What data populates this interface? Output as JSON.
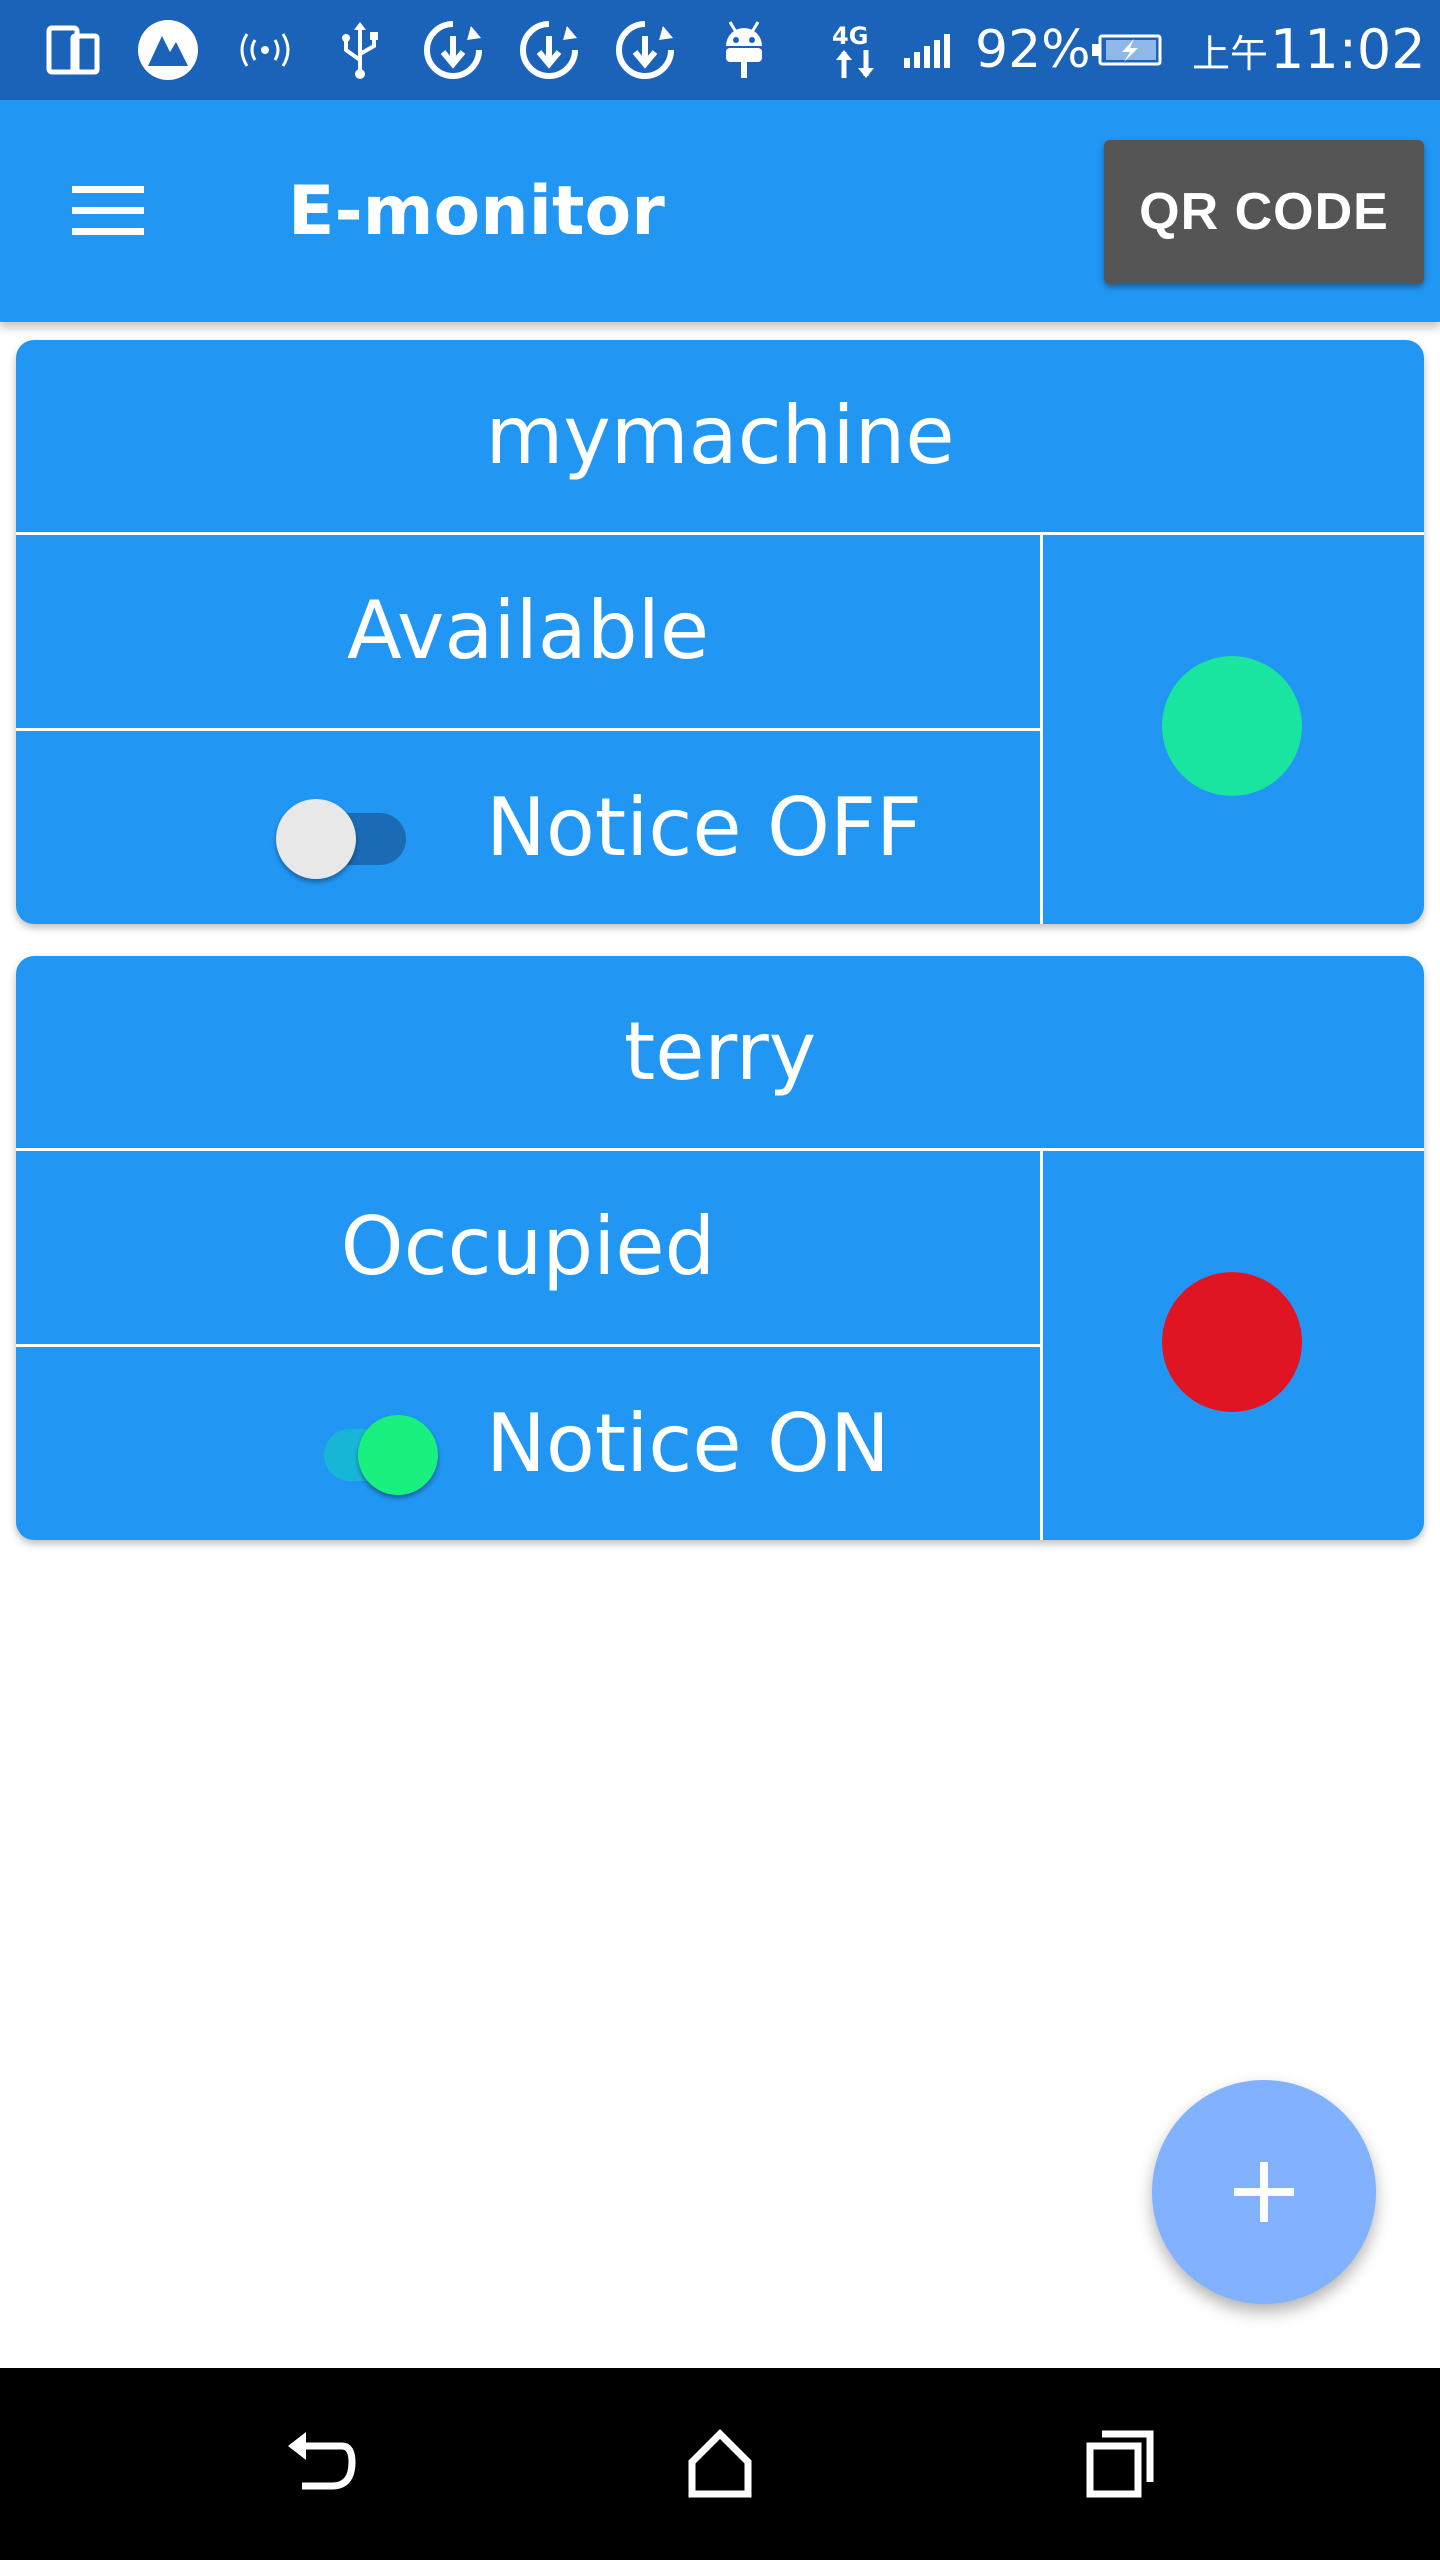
{
  "status_bar": {
    "battery_percent": "92%",
    "ampm": "上午",
    "time": "11:02",
    "icons": [
      "screen-mirror-icon",
      "app-logo-icon",
      "hotspot-icon",
      "usb-icon",
      "sync-download-icon",
      "download-icon",
      "download-icon",
      "android-icon",
      "network-4g-icon",
      "signal-icon",
      "battery-charging-icon"
    ]
  },
  "app_bar": {
    "menu_icon": "hamburger-menu-icon",
    "title": "E-monitor",
    "qr_button_label": "QR CODE"
  },
  "devices": [
    {
      "name": "mymachine",
      "status": "Available",
      "notice_label": "Notice OFF",
      "notice_enabled": false,
      "status_color": "#19e5a0"
    },
    {
      "name": "terry",
      "status": "Occupied",
      "notice_label": "Notice ON",
      "notice_enabled": true,
      "status_color": "#e01423"
    }
  ],
  "fab": {
    "icon": "plus-icon"
  },
  "nav_bar": {
    "buttons": [
      "back-icon",
      "home-icon",
      "recents-icon"
    ]
  },
  "colors": {
    "status_bar": "#1a63b8",
    "primary": "#2196f3",
    "qr_button": "#555555",
    "fab": "#82b1ff",
    "nav_bar": "#000000"
  }
}
